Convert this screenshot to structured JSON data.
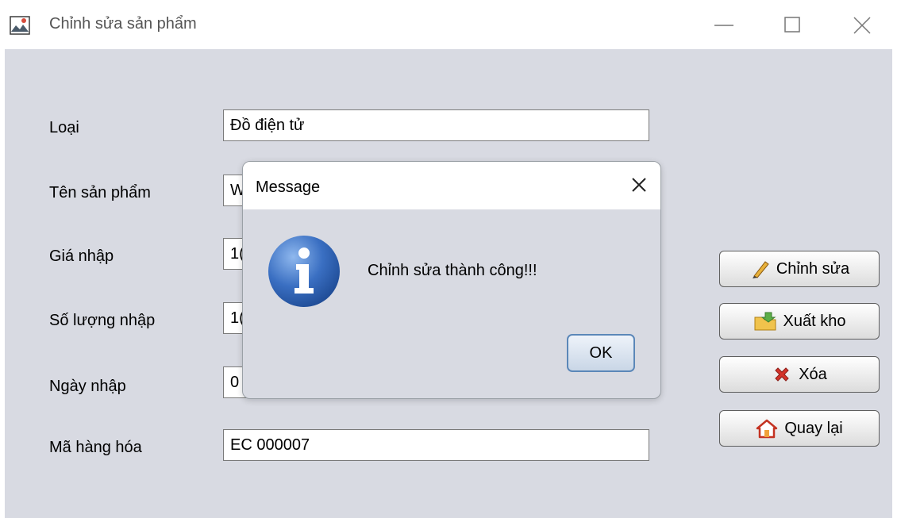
{
  "window": {
    "title": "Chỉnh sửa sản phẩm",
    "app_icon": "app-window-icon",
    "controls": [
      "minimize-icon",
      "maximize-icon",
      "close-icon"
    ]
  },
  "form": {
    "fields": [
      {
        "label": "Loại",
        "value": "Đồ điện tử"
      },
      {
        "label": "Tên sản phẩm",
        "value": "W"
      },
      {
        "label": "Giá nhập",
        "value": "1("
      },
      {
        "label": "Số lượng nhập",
        "value": "1("
      },
      {
        "label": "Ngày nhập",
        "value": "0"
      },
      {
        "label": "Mã hàng hóa",
        "value": "EC 000007"
      }
    ]
  },
  "actions": {
    "edit": {
      "label": "Chỉnh sửa",
      "icon": "pencil-icon"
    },
    "export": {
      "label": "Xuất kho",
      "icon": "folder-icon"
    },
    "delete": {
      "label": "Xóa",
      "icon": "delete-x-icon"
    },
    "back": {
      "label": "Quay lại",
      "icon": "home-icon"
    }
  },
  "dialog": {
    "title": "Message",
    "message": "Chỉnh sửa thành công!!!",
    "ok_label": "OK",
    "icon": "info-icon"
  },
  "colors": {
    "content_background": "#d8dae2",
    "dialog_title_background": "#ffffff",
    "info_icon_blue": "#2d62b0",
    "ok_button_border": "#5b87b8"
  }
}
